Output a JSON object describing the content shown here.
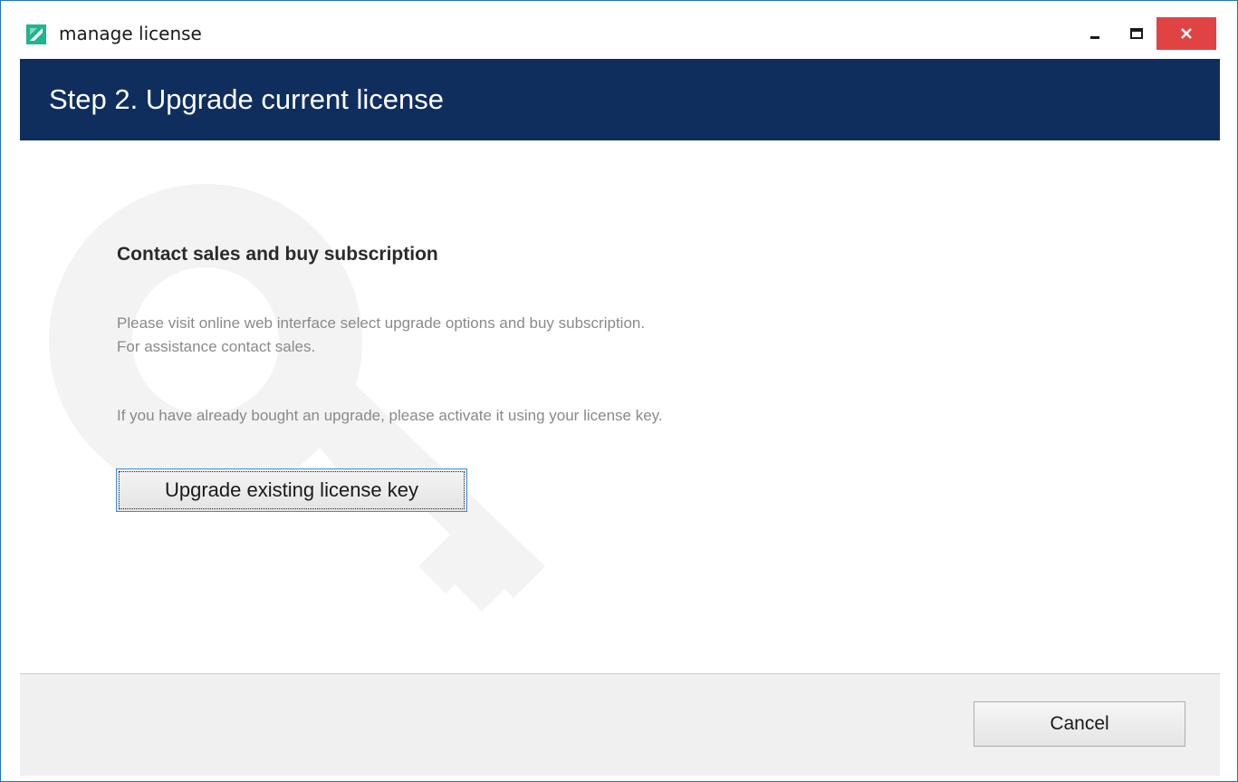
{
  "window": {
    "title": "manage license",
    "icon": "app-logo-icon",
    "controls": {
      "minimize_icon": "minimize-icon",
      "maximize_icon": "maximize-icon",
      "close_icon": "close-icon"
    }
  },
  "header": {
    "title": "Step 2. Upgrade current license"
  },
  "main": {
    "section_title": "Contact sales and buy subscription",
    "paragraph_line1": "Please visit online web interface select upgrade options and buy subscription.",
    "paragraph_line2": "For assistance contact sales.",
    "paragraph_activate": "If you have already bought an upgrade, please activate it using your license key.",
    "upgrade_button_label": "Upgrade existing license key",
    "watermark_icon": "key-icon"
  },
  "footer": {
    "cancel_label": "Cancel"
  },
  "colors": {
    "header_bg": "#0f2e5e",
    "close_button_bg": "#e04343",
    "window_border": "#1e74c9",
    "focus_border": "#3c8ddc"
  }
}
